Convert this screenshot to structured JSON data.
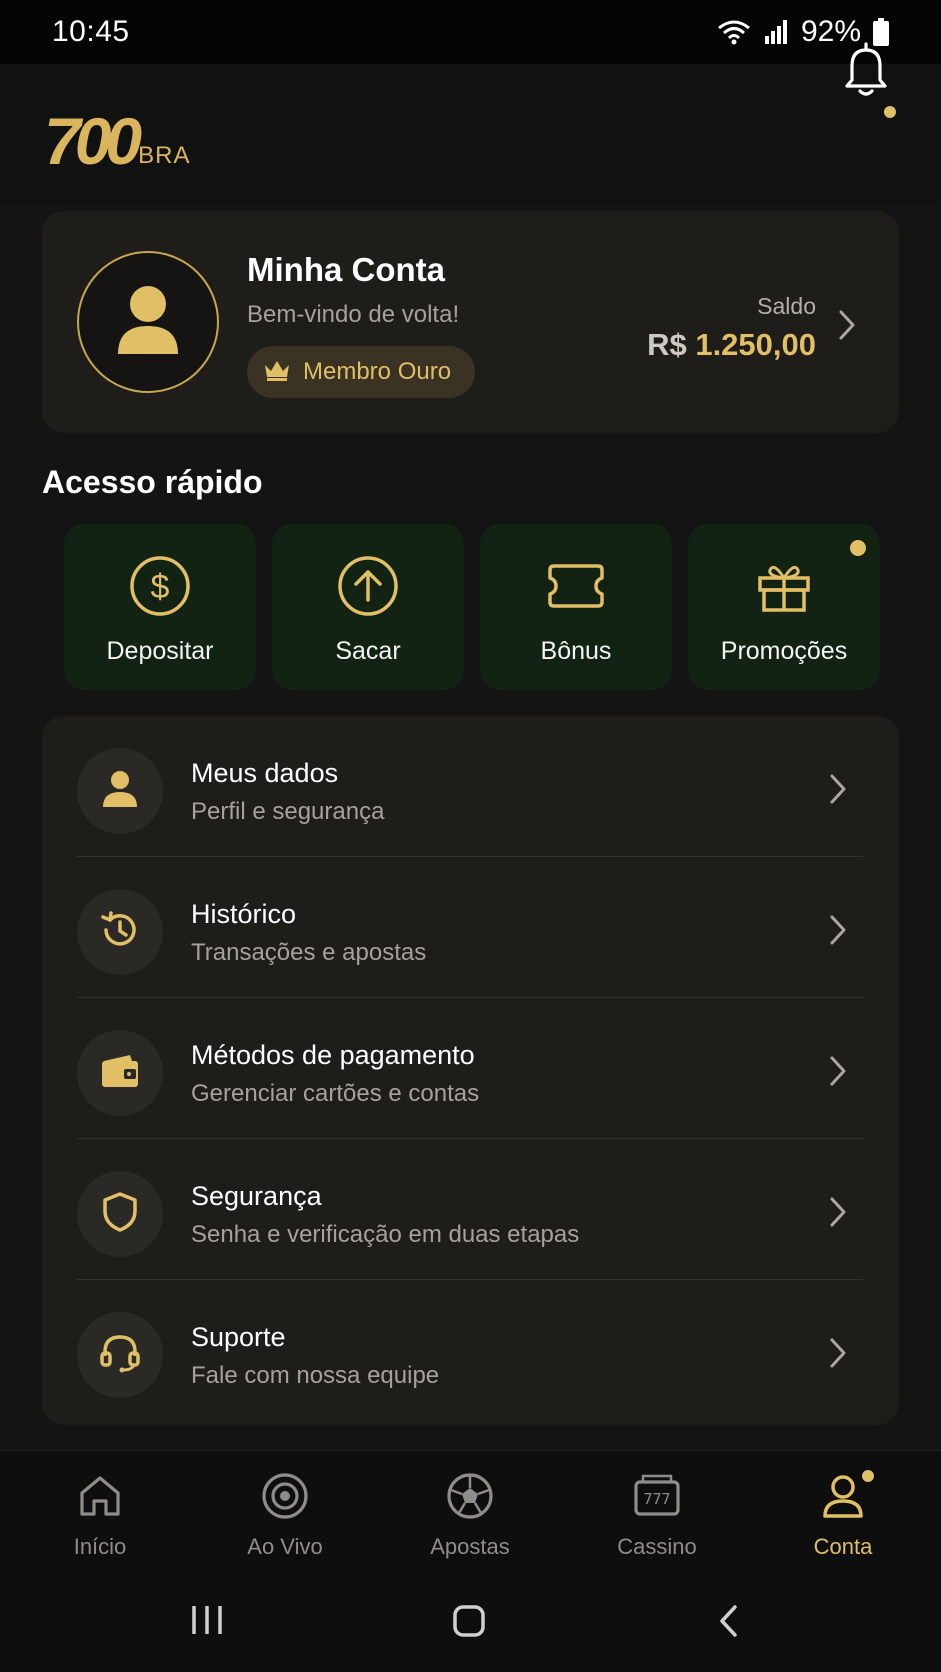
{
  "status": {
    "time": "10:45",
    "battery": "92%"
  },
  "header": {
    "logo_main": "700",
    "logo_sub": "BRA",
    "notification_dot": true
  },
  "account": {
    "title": "Minha Conta",
    "subtitle": "Bem-vindo de volta!",
    "member_badge": "Membro Ouro",
    "balance_label": "Saldo",
    "balance_currency": "R$",
    "balance_value": "1.250,00"
  },
  "quick_access": {
    "title": "Acesso rápido",
    "items": [
      {
        "label": "Depositar",
        "icon": "dollar-circle-icon"
      },
      {
        "label": "Sacar",
        "icon": "arrow-up-circle-icon"
      },
      {
        "label": "Bônus",
        "icon": "ticket-icon"
      },
      {
        "label": "Promoções",
        "icon": "gift-icon",
        "badge_dot": true
      }
    ]
  },
  "menu": {
    "items": [
      {
        "title": "Meus dados",
        "subtitle": "Perfil e segurança",
        "icon": "user-icon"
      },
      {
        "title": "Histórico",
        "subtitle": "Transações e apostas",
        "icon": "history-icon"
      },
      {
        "title": "Métodos de pagamento",
        "subtitle": "Gerenciar cartões e contas",
        "icon": "wallet-icon"
      },
      {
        "title": "Segurança",
        "subtitle": "Senha e verificação em duas etapas",
        "icon": "shield-icon"
      },
      {
        "title": "Suporte",
        "subtitle": "Fale com nossa equipe",
        "icon": "headset-icon"
      }
    ]
  },
  "bottom_nav": {
    "items": [
      {
        "label": "Início",
        "icon": "home-icon"
      },
      {
        "label": "Ao Vivo",
        "icon": "live-icon"
      },
      {
        "label": "Apostas",
        "icon": "soccer-ball-icon"
      },
      {
        "label": "Cassino",
        "icon": "slot-machine-icon"
      },
      {
        "label": "Conta",
        "icon": "account-icon",
        "active": true
      }
    ]
  },
  "colors": {
    "gold": "#e1bf66",
    "card": "#1f1d1a",
    "tile_green": "#132313",
    "background": "#141414"
  }
}
